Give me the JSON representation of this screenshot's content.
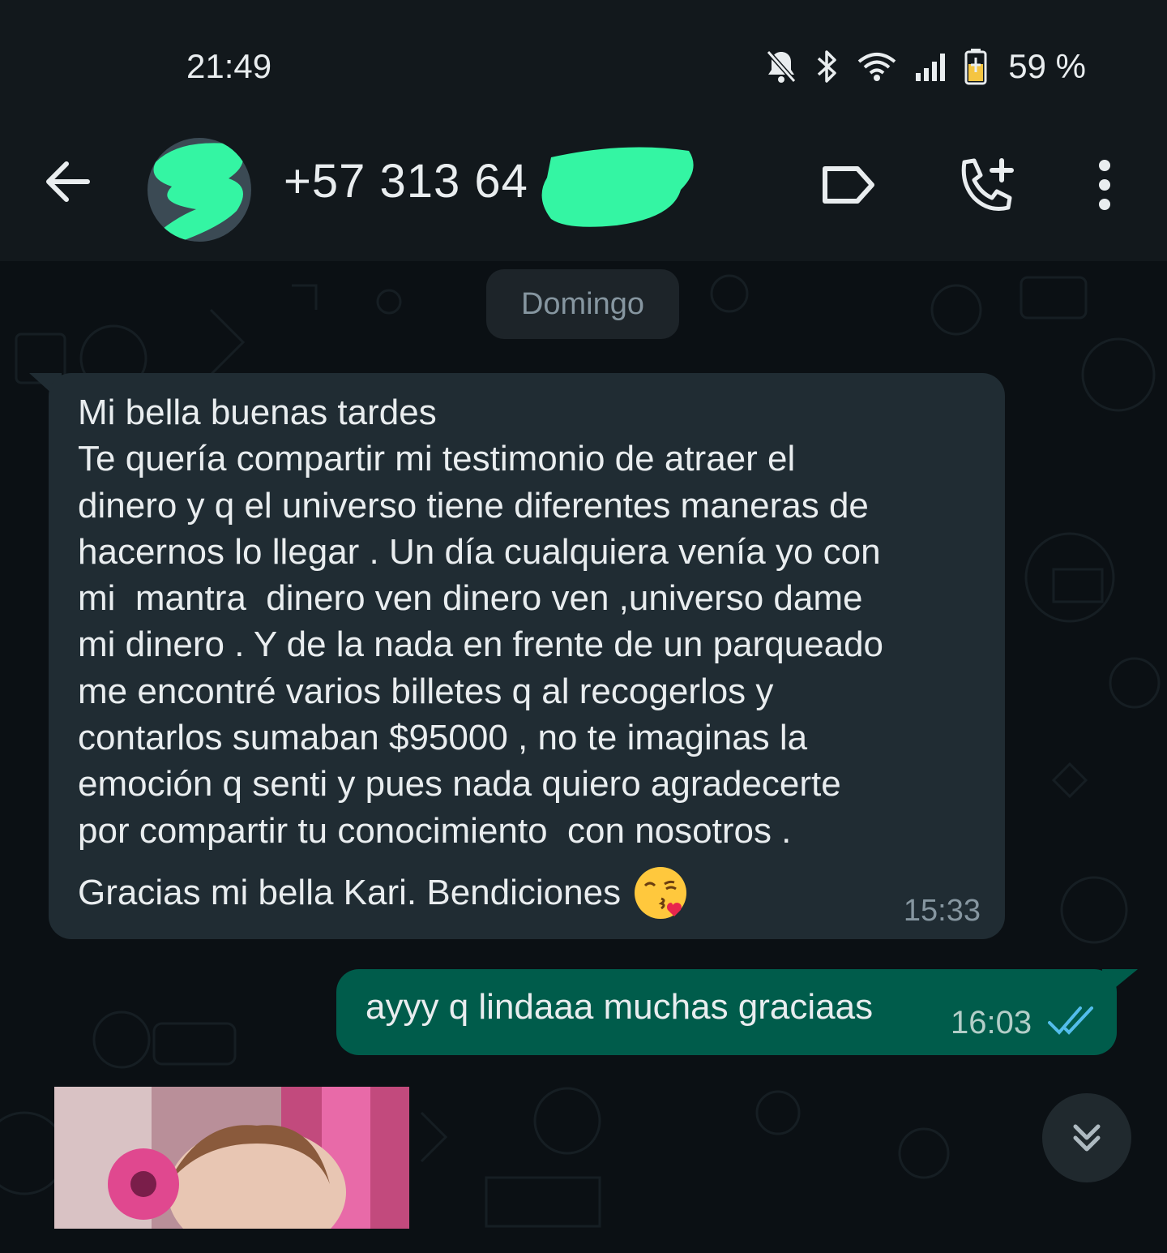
{
  "status_bar": {
    "time": "21:49",
    "battery": "59 %",
    "icons": [
      "mute-bell-icon",
      "bluetooth-icon",
      "wifi-icon",
      "signal-icon",
      "battery-icon"
    ]
  },
  "header": {
    "contact_name": "+57 313 64",
    "icons": [
      "back-arrow-icon",
      "label-icon",
      "add-call-icon",
      "more-vert-icon"
    ]
  },
  "chat": {
    "date_chip": "Domingo",
    "incoming": {
      "text": "Mi bella buenas tardes\nTe quería compartir mi testimonio de atraer el\ndinero y q el universo tiene diferentes maneras de\nhacernos lo llegar . Un día cualquiera venía yo con\nmi  mantra  dinero ven dinero ven ,universo dame\nmi dinero . Y de la nada en frente de un parqueado\nme encontré varios billetes q al recogerlos y\ncontarlos sumaban $95000 , no te imaginas la\nemoción q senti y pues nada quiero agradecerte\npor compartir tu conocimiento  con nosotros .",
      "thanks": "Gracias mi bella Kari. Bendiciones",
      "emoji": "kissing-face-with-heart-emoji",
      "time": "15:33"
    },
    "outgoing": {
      "text": "ayyy q lindaaa muchas graciaas",
      "time": "16:03",
      "status": "read"
    }
  },
  "colors": {
    "header_bg": "#12181c",
    "chat_bg": "#0b1014",
    "incoming_bubble": "#202c33",
    "outgoing_bubble": "#005c4b",
    "read_ticks": "#53bdeb",
    "redaction": "#34f5a3"
  }
}
